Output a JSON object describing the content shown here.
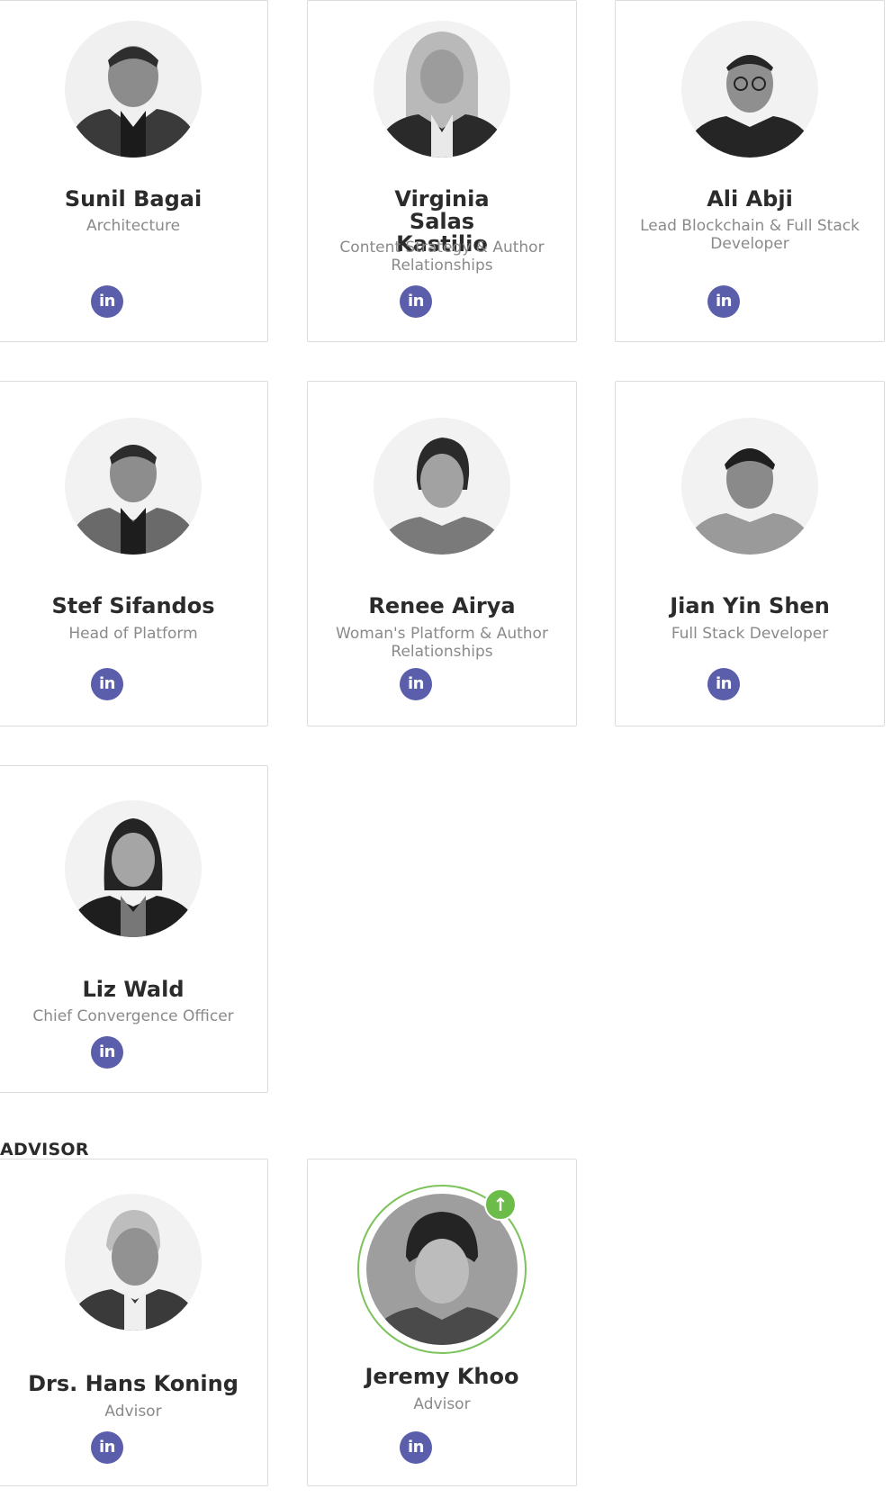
{
  "team": [
    {
      "name": "Sunil Bagai",
      "role": "Architecture",
      "linkedin_label": "in",
      "photo_icon": "person-photo"
    },
    {
      "name": "Virginia Salas Kastilio",
      "role": "Content Strategy & Author Relationships",
      "linkedin_label": "in",
      "photo_icon": "person-photo"
    },
    {
      "name": "Ali Abji",
      "role": "Lead Blockchain & Full Stack Developer",
      "linkedin_label": "in",
      "photo_icon": "person-photo"
    },
    {
      "name": "Stef Sifandos",
      "role": "Head of Platform",
      "linkedin_label": "in",
      "photo_icon": "person-photo"
    },
    {
      "name": "Renee Airya",
      "role": "Woman's Platform & Author Relationships",
      "linkedin_label": "in",
      "photo_icon": "person-photo"
    },
    {
      "name": "Jian Yin Shen",
      "role": "Full Stack Developer",
      "linkedin_label": "in",
      "photo_icon": "person-photo"
    },
    {
      "name": "Liz Wald",
      "role": "Chief Convergence Officer",
      "linkedin_label": "in",
      "photo_icon": "person-photo"
    }
  ],
  "advisor_section": {
    "title": "ADVISOR",
    "members": [
      {
        "name": "Drs. Hans Koning",
        "role": "Advisor",
        "linkedin_label": "in",
        "photo_icon": "person-photo"
      },
      {
        "name": "Jeremy Khoo",
        "role": "Advisor",
        "linkedin_label": "in",
        "photo_icon": "person-photo",
        "badge_icon": "arrow-up-icon",
        "badge_glyph": "↑"
      }
    ]
  },
  "colors": {
    "linkedin": "#5b5fab",
    "highlight_ring": "#7cc35c",
    "name_text": "#2b2b2b",
    "role_text": "#8a8a8a",
    "card_border": "#dcdcdc"
  }
}
